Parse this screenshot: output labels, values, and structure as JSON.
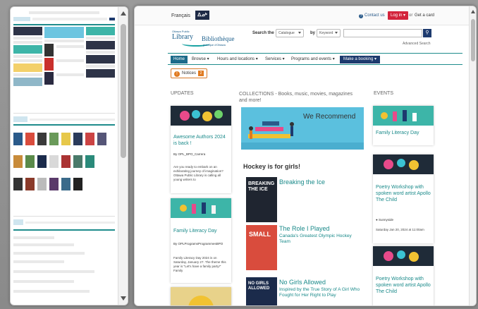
{
  "topbar": {
    "language": "Français",
    "inuktitut": "ᐃᓄᒃ",
    "contact": "Contact us",
    "login": "Log in",
    "or": "or",
    "get_card": "Get a card"
  },
  "logo": {
    "line1": "Ottawa Public",
    "library": "Library",
    "bibliotheque": "Bibliothèque",
    "line4": "publique d'Ottawa"
  },
  "search": {
    "label": "Search the",
    "scope": "Catalogue",
    "by_label": "by",
    "by_value": "Keyword",
    "query": "",
    "advanced": "Advanced Search"
  },
  "nav": {
    "items": [
      {
        "label": "Home"
      },
      {
        "label": "Browse ▾"
      },
      {
        "label": "Hours and locations ▾"
      },
      {
        "label": "Services ▾"
      },
      {
        "label": "Programs and events ▾"
      },
      {
        "label": "Make a booking ▾"
      }
    ]
  },
  "notices": {
    "label": "Notices",
    "count": "2",
    "icon": "!"
  },
  "columns": {
    "updates": "UPDATES",
    "collections": "COLLECTIONS - Books, music, movies, magazines",
    "collections2": "and more!",
    "events": "EVENTS"
  },
  "updates": [
    {
      "title": "Awesome Authors 2024 is back !",
      "author": "By OPL_BPO_Carrera",
      "text": "Are you ready to embark on an exhilarating journey of imagination? Ottawa Public Library is calling all young writers to"
    },
    {
      "title": "Family Literacy Day",
      "author": "By OPLProgramsProgrammesBPO",
      "text": "Family Literacy Day 2024 is on Saturday, January 27. The theme this year is \"Let's have a family party!\" Family"
    }
  ],
  "collections": {
    "banner": "We Recommend",
    "heading": "Hockey is for girls!",
    "books": [
      {
        "title": "Breaking the Ice",
        "subtitle": "",
        "cover_text": "BREAKING THE ICE"
      },
      {
        "title": "The Role I Played",
        "subtitle": "Canada's Greatest Olympic Hockey Team",
        "cover_text": "SMALL"
      },
      {
        "title": "No Girls Allowed",
        "subtitle": "Inspired by the True Story of A Girl Who Fought for Her Right to Play",
        "cover_text": "NO GIRLS ALLOWED"
      }
    ]
  },
  "events": [
    {
      "title": "Family Literacy Day",
      "location": "",
      "date": ""
    },
    {
      "title": "Poetry Workshop with spoken word artist Apollo The Child",
      "location": "Sunnyside",
      "date": "Saturday Jan 20, 2024 at 11:00am"
    },
    {
      "title": "Poetry Workshop with spoken word artist Apollo The Child",
      "location": "",
      "date": ""
    }
  ],
  "colors": {
    "teal": "#1a8a8a",
    "navy": "#1d3a6e",
    "red": "#d3243c",
    "orange": "#e07a20"
  }
}
